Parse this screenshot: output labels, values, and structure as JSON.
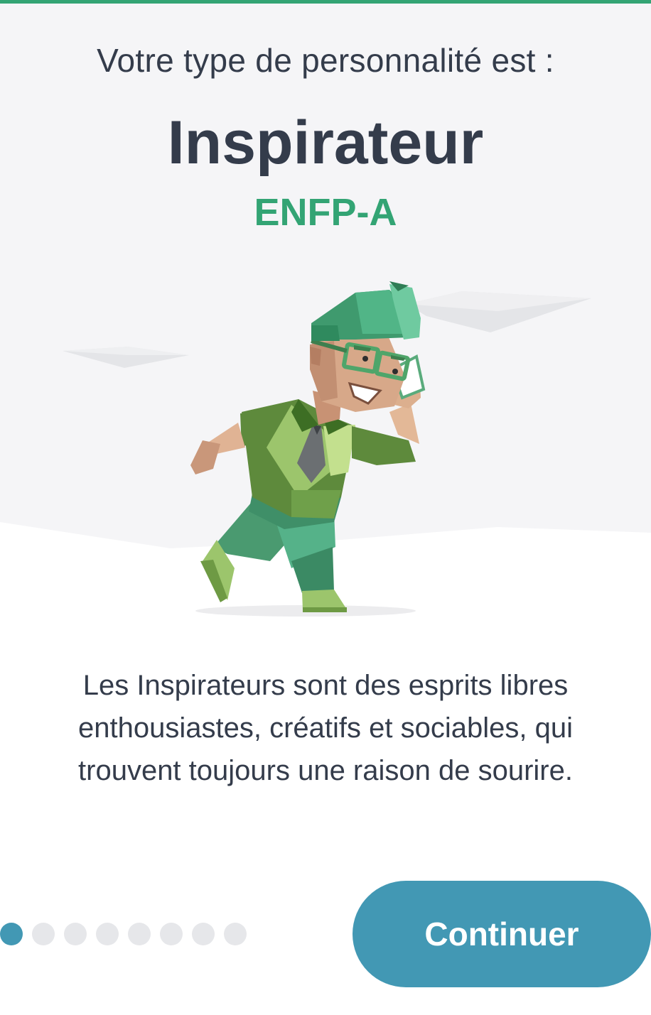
{
  "colors": {
    "accent_green": "#33a474",
    "button_blue": "#4298b4",
    "text_dark": "#343c4b",
    "hero_background": "#f5f5f7"
  },
  "header": {
    "intro": "Votre type de personnalité est :",
    "type_name": "Inspirateur",
    "type_code": "ENFP-A"
  },
  "illustration": {
    "name": "inspirateur-character-illustration"
  },
  "description": "Les Inspirateurs sont des esprits libres enthousiastes, créatifs et sociables, qui trouvent toujours une raison de sourire.",
  "pagination": {
    "total": 8,
    "active_index": 0
  },
  "actions": {
    "continue_label": "Continuer"
  }
}
